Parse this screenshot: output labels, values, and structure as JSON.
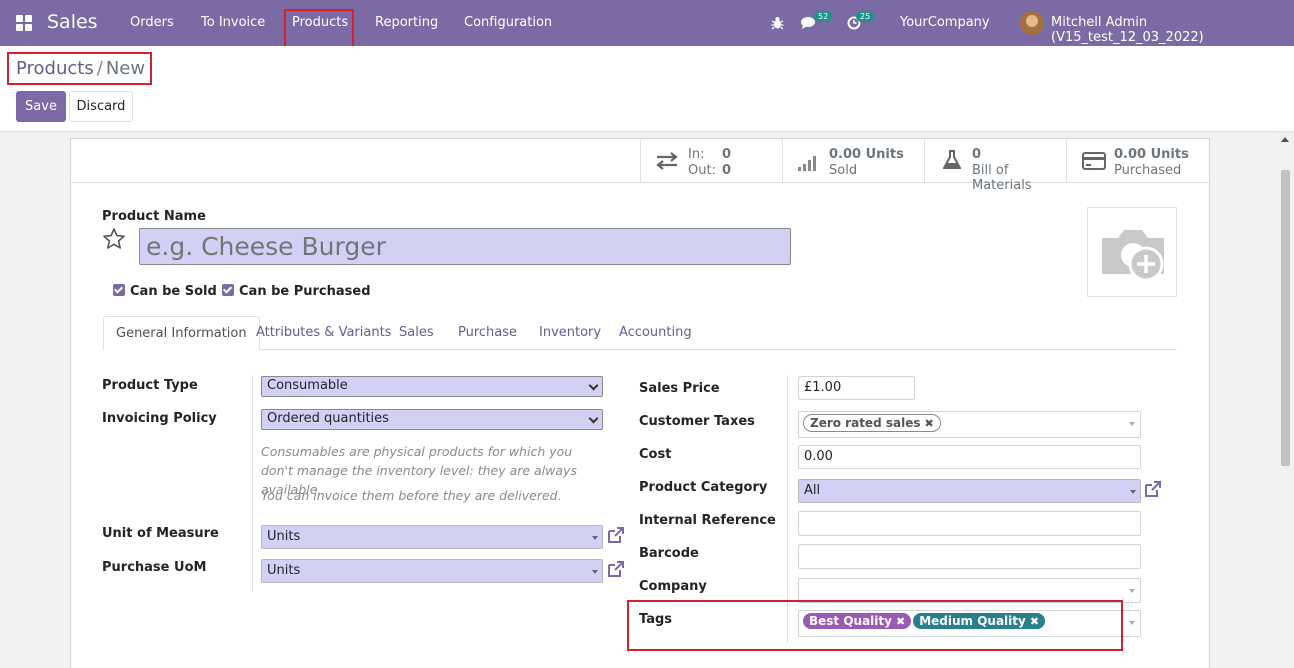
{
  "navbar": {
    "app_name": "Sales",
    "menu": [
      "Orders",
      "To Invoice",
      "Products",
      "Reporting",
      "Configuration"
    ],
    "messages_count": "52",
    "activities_count": "25",
    "company": "YourCompany",
    "user": "Mitchell Admin (V15_test_12_03_2022)"
  },
  "breadcrumb": {
    "parent": "Products",
    "separator": "/",
    "current": "New"
  },
  "buttons": {
    "save": "Save",
    "discard": "Discard"
  },
  "stats": {
    "in_label": "In:",
    "in_value": "0",
    "out_label": "Out:",
    "out_value": "0",
    "sold_value": "0.00 Units",
    "sold_label": "Sold",
    "bom_value": "0",
    "bom_label": "Bill of Materials",
    "purchased_value": "0.00 Units",
    "purchased_label": "Purchased"
  },
  "product": {
    "name_label": "Product Name",
    "name_placeholder": "e.g. Cheese Burger",
    "can_be_sold": "Can be Sold",
    "can_be_purchased": "Can be Purchased"
  },
  "tabs": [
    "General Information",
    "Attributes & Variants",
    "Sales",
    "Purchase",
    "Inventory",
    "Accounting"
  ],
  "left_fields": {
    "product_type_label": "Product Type",
    "product_type": "Consumable",
    "invoicing_policy_label": "Invoicing Policy",
    "invoicing_policy": "Ordered quantities",
    "help1": "Consumables are physical products for which you don't manage the inventory level: they are always available.",
    "help2": "You can invoice them before they are delivered.",
    "uom_label": "Unit of Measure",
    "uom": "Units",
    "purchase_uom_label": "Purchase UoM",
    "purchase_uom": "Units"
  },
  "right_fields": {
    "sales_price_label": "Sales Price",
    "sales_price": "£1.00",
    "customer_taxes_label": "Customer Taxes",
    "customer_tax_tag": "Zero rated sales",
    "cost_label": "Cost",
    "cost": "0.00",
    "category_label": "Product Category",
    "category": "All",
    "internal_ref_label": "Internal Reference",
    "barcode_label": "Barcode",
    "company_label": "Company",
    "tags_label": "Tags",
    "tags": [
      "Best Quality",
      "Medium Quality"
    ]
  },
  "colors": {
    "brand": "#7c6aa5",
    "field_required": "#d2d0f5",
    "highlight": "#d3212c"
  }
}
